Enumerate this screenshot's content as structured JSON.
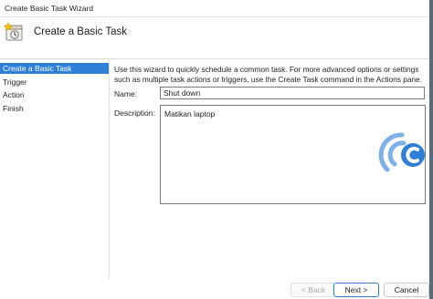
{
  "window": {
    "title": "Create Basic Task Wizard"
  },
  "header": {
    "title": "Create a Basic Task",
    "icon": "task-scheduler-icon"
  },
  "sidebar": {
    "items": [
      {
        "label": "Create a Basic Task",
        "active": true
      },
      {
        "label": "Trigger",
        "active": false
      },
      {
        "label": "Action",
        "active": false
      },
      {
        "label": "Finish",
        "active": false
      }
    ]
  },
  "main": {
    "intro": "Use this wizard to quickly schedule a common task.  For more advanced options or settings such as multiple task actions or triggers, use the Create Task command in the Actions pane.",
    "name_label": "Name:",
    "name_value": "Shut down",
    "description_label": "Description:",
    "description_value": "Matikan laptop"
  },
  "footer": {
    "back_label": "< Back",
    "next_label": "Next >",
    "cancel_label": "Cancel"
  },
  "colors": {
    "accent": "#2f7ed8",
    "watermark": "#2f7ed8"
  }
}
